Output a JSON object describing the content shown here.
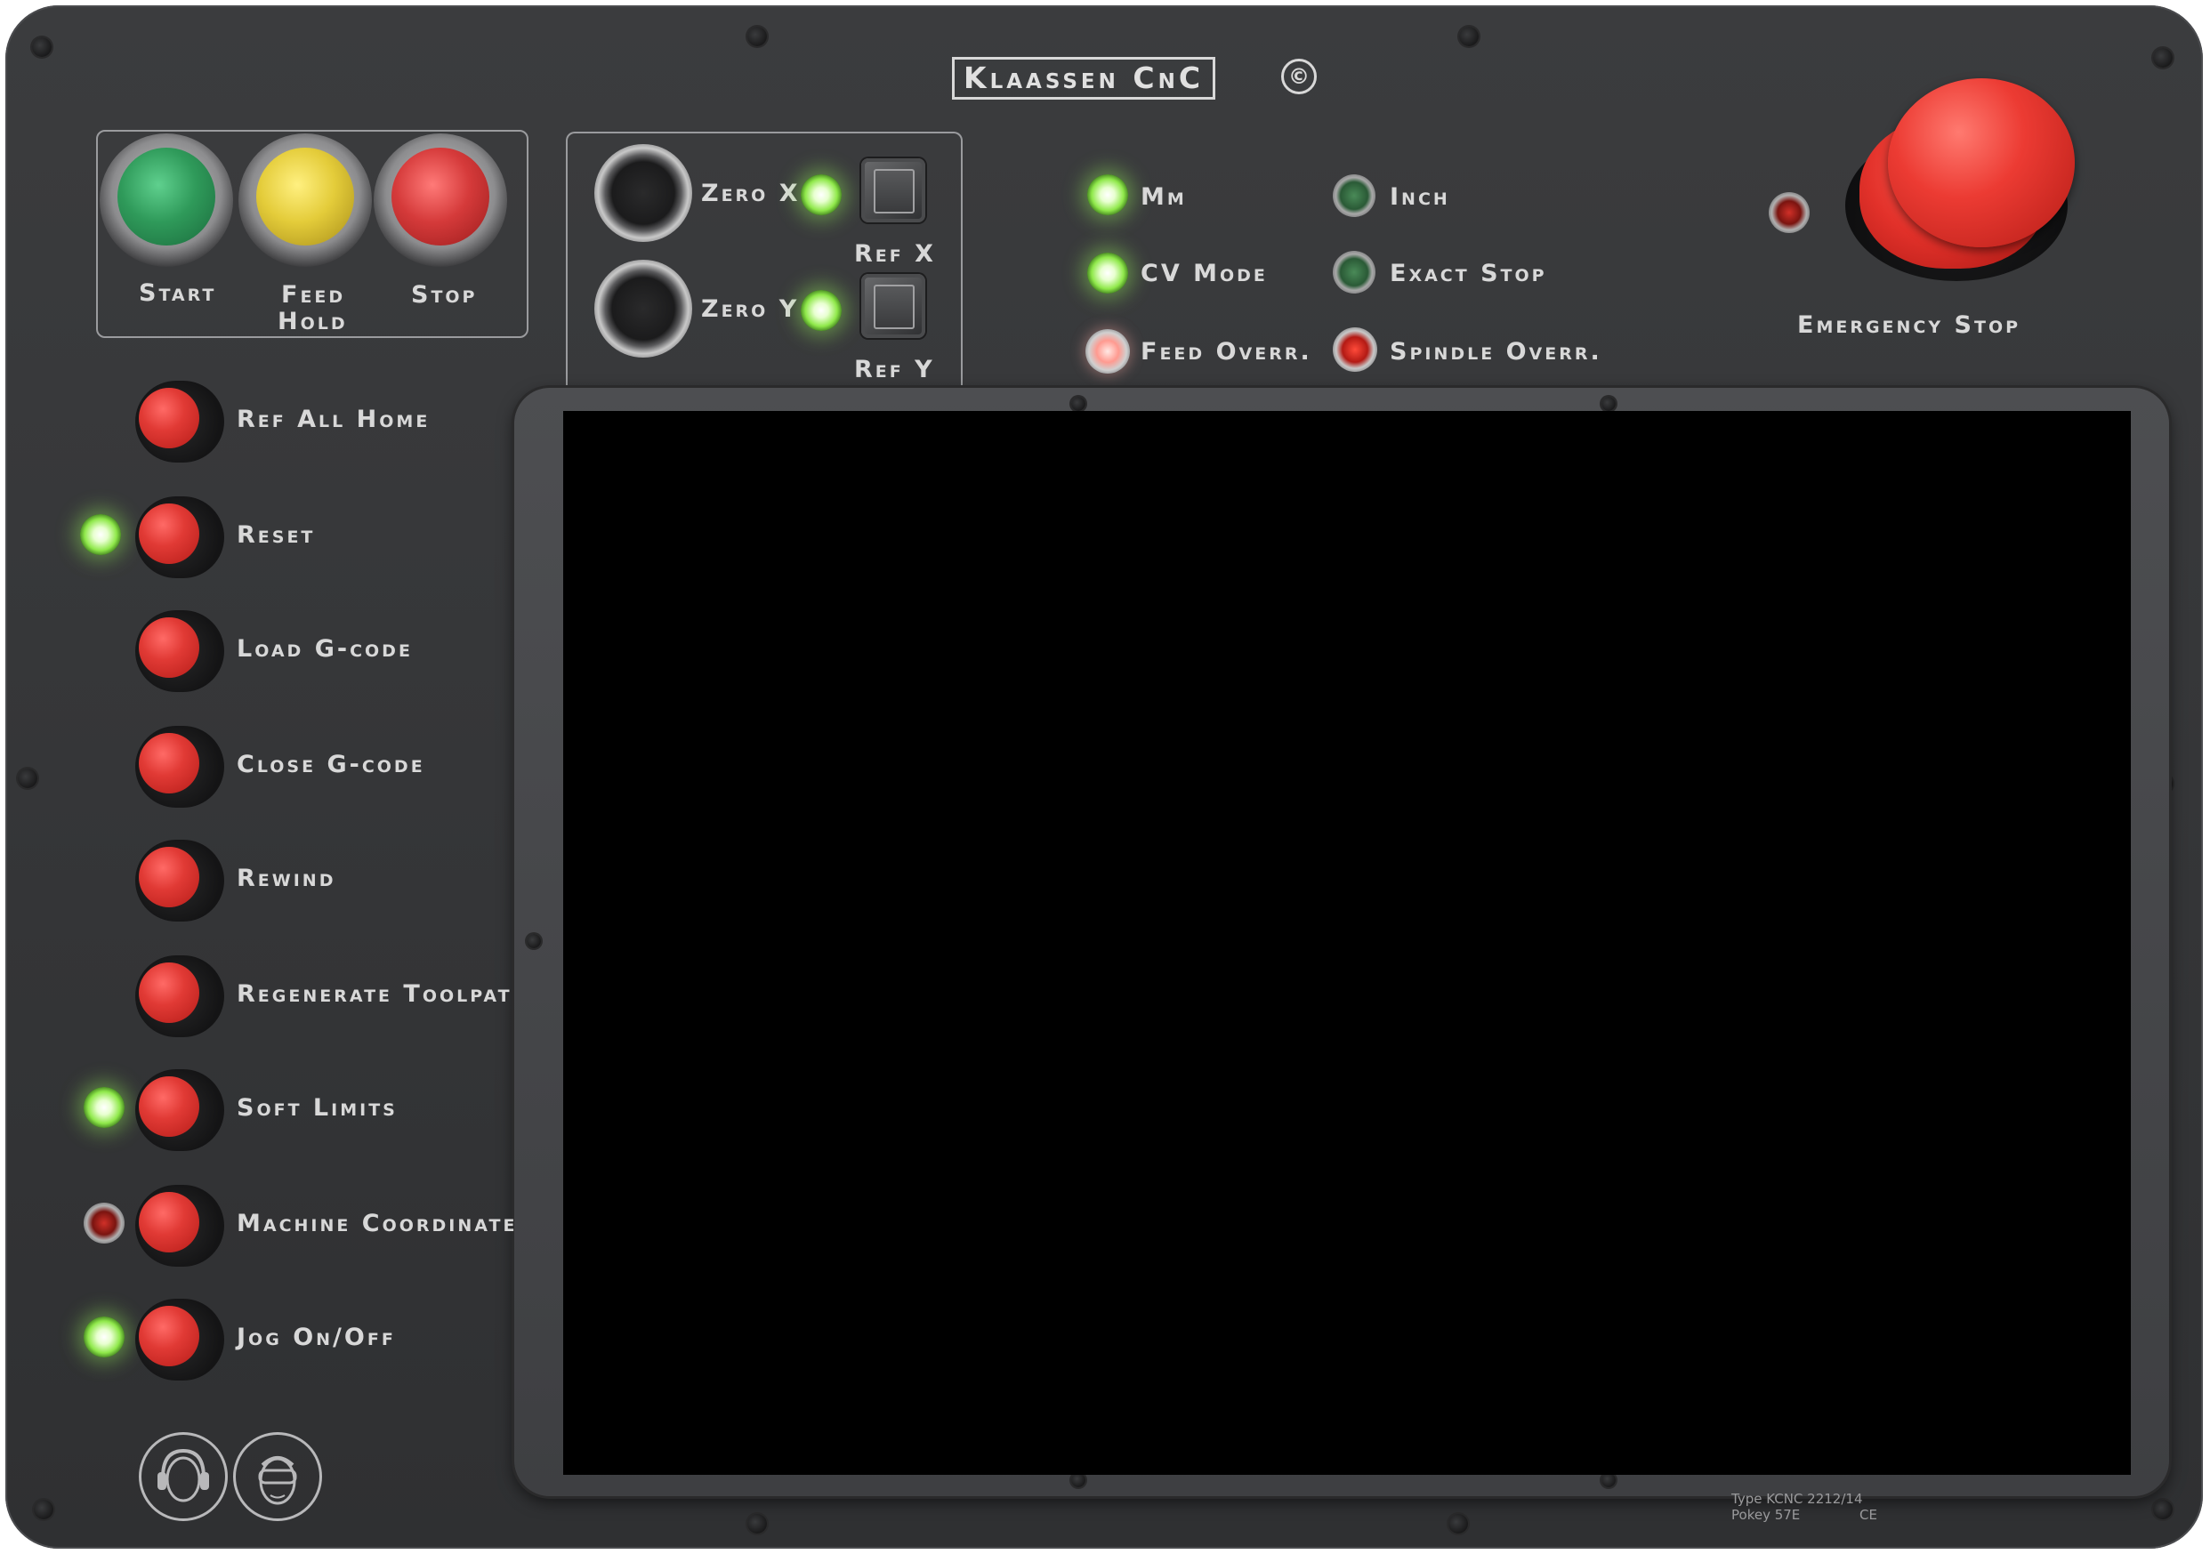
{
  "brand": {
    "name": "Klaassen CnC",
    "copyright_symbol": "©"
  },
  "top_buttons": {
    "start": "Start",
    "feed_hold_line1": "Feed",
    "feed_hold_line2": "Hold",
    "stop": "Stop"
  },
  "zero_panel": {
    "zero_x": "Zero X",
    "ref_x": "Ref X",
    "zero_y": "Zero Y",
    "ref_y": "Ref Y"
  },
  "mode_leds": {
    "mm": "Mm",
    "inch": "Inch",
    "cv_mode": "CV Mode",
    "exact_stop": "Exact Stop",
    "feed_overr": "Feed Overr.",
    "spindle_overr": "Spindle Overr."
  },
  "emergency_stop": {
    "label": "Emergency Stop"
  },
  "side_buttons": [
    {
      "label": "Ref All Home",
      "led": "none"
    },
    {
      "label": "Reset",
      "led": "green"
    },
    {
      "label": "Load G-code",
      "led": "none"
    },
    {
      "label": "Close G-code",
      "led": "none"
    },
    {
      "label": "Rewind",
      "led": "none"
    },
    {
      "label": "Regenerate Toolpat",
      "led": "none"
    },
    {
      "label": "Soft Limits",
      "led": "green"
    },
    {
      "label": "Machine Coordinate",
      "led": "red"
    },
    {
      "label": "Jog On/Off",
      "led": "green"
    }
  ],
  "type_plate": {
    "line1": "Type KCNC 2212/14",
    "line2": "Pokey 57E",
    "ce": "CE"
  },
  "colors": {
    "panel": "#353638",
    "label_text": "#d8d8d8",
    "led_on_green": "#8fe84a",
    "button_red": "#e13a35",
    "start_green": "#2f9a5a",
    "feed_hold_yellow": "#e4cc3a",
    "stop_red": "#d53a3a",
    "screen": "#000000"
  },
  "icons": {
    "ppe_1": "ear-protection-icon",
    "ppe_2": "safety-goggles-icon"
  }
}
